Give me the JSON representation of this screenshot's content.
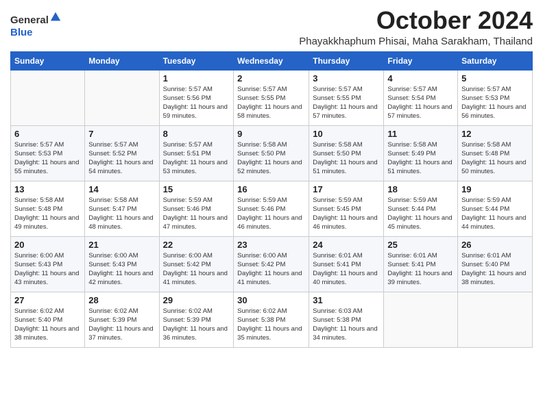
{
  "header": {
    "logo_general": "General",
    "logo_blue": "Blue",
    "month": "October 2024",
    "location": "Phayakkhaphum Phisai, Maha Sarakham, Thailand"
  },
  "weekdays": [
    "Sunday",
    "Monday",
    "Tuesday",
    "Wednesday",
    "Thursday",
    "Friday",
    "Saturday"
  ],
  "weeks": [
    [
      {
        "day": "",
        "sunrise": "",
        "sunset": "",
        "daylight": ""
      },
      {
        "day": "",
        "sunrise": "",
        "sunset": "",
        "daylight": ""
      },
      {
        "day": "1",
        "sunrise": "Sunrise: 5:57 AM",
        "sunset": "Sunset: 5:56 PM",
        "daylight": "Daylight: 11 hours and 59 minutes."
      },
      {
        "day": "2",
        "sunrise": "Sunrise: 5:57 AM",
        "sunset": "Sunset: 5:55 PM",
        "daylight": "Daylight: 11 hours and 58 minutes."
      },
      {
        "day": "3",
        "sunrise": "Sunrise: 5:57 AM",
        "sunset": "Sunset: 5:55 PM",
        "daylight": "Daylight: 11 hours and 57 minutes."
      },
      {
        "day": "4",
        "sunrise": "Sunrise: 5:57 AM",
        "sunset": "Sunset: 5:54 PM",
        "daylight": "Daylight: 11 hours and 57 minutes."
      },
      {
        "day": "5",
        "sunrise": "Sunrise: 5:57 AM",
        "sunset": "Sunset: 5:53 PM",
        "daylight": "Daylight: 11 hours and 56 minutes."
      }
    ],
    [
      {
        "day": "6",
        "sunrise": "Sunrise: 5:57 AM",
        "sunset": "Sunset: 5:53 PM",
        "daylight": "Daylight: 11 hours and 55 minutes."
      },
      {
        "day": "7",
        "sunrise": "Sunrise: 5:57 AM",
        "sunset": "Sunset: 5:52 PM",
        "daylight": "Daylight: 11 hours and 54 minutes."
      },
      {
        "day": "8",
        "sunrise": "Sunrise: 5:57 AM",
        "sunset": "Sunset: 5:51 PM",
        "daylight": "Daylight: 11 hours and 53 minutes."
      },
      {
        "day": "9",
        "sunrise": "Sunrise: 5:58 AM",
        "sunset": "Sunset: 5:50 PM",
        "daylight": "Daylight: 11 hours and 52 minutes."
      },
      {
        "day": "10",
        "sunrise": "Sunrise: 5:58 AM",
        "sunset": "Sunset: 5:50 PM",
        "daylight": "Daylight: 11 hours and 51 minutes."
      },
      {
        "day": "11",
        "sunrise": "Sunrise: 5:58 AM",
        "sunset": "Sunset: 5:49 PM",
        "daylight": "Daylight: 11 hours and 51 minutes."
      },
      {
        "day": "12",
        "sunrise": "Sunrise: 5:58 AM",
        "sunset": "Sunset: 5:48 PM",
        "daylight": "Daylight: 11 hours and 50 minutes."
      }
    ],
    [
      {
        "day": "13",
        "sunrise": "Sunrise: 5:58 AM",
        "sunset": "Sunset: 5:48 PM",
        "daylight": "Daylight: 11 hours and 49 minutes."
      },
      {
        "day": "14",
        "sunrise": "Sunrise: 5:58 AM",
        "sunset": "Sunset: 5:47 PM",
        "daylight": "Daylight: 11 hours and 48 minutes."
      },
      {
        "day": "15",
        "sunrise": "Sunrise: 5:59 AM",
        "sunset": "Sunset: 5:46 PM",
        "daylight": "Daylight: 11 hours and 47 minutes."
      },
      {
        "day": "16",
        "sunrise": "Sunrise: 5:59 AM",
        "sunset": "Sunset: 5:46 PM",
        "daylight": "Daylight: 11 hours and 46 minutes."
      },
      {
        "day": "17",
        "sunrise": "Sunrise: 5:59 AM",
        "sunset": "Sunset: 5:45 PM",
        "daylight": "Daylight: 11 hours and 46 minutes."
      },
      {
        "day": "18",
        "sunrise": "Sunrise: 5:59 AM",
        "sunset": "Sunset: 5:44 PM",
        "daylight": "Daylight: 11 hours and 45 minutes."
      },
      {
        "day": "19",
        "sunrise": "Sunrise: 5:59 AM",
        "sunset": "Sunset: 5:44 PM",
        "daylight": "Daylight: 11 hours and 44 minutes."
      }
    ],
    [
      {
        "day": "20",
        "sunrise": "Sunrise: 6:00 AM",
        "sunset": "Sunset: 5:43 PM",
        "daylight": "Daylight: 11 hours and 43 minutes."
      },
      {
        "day": "21",
        "sunrise": "Sunrise: 6:00 AM",
        "sunset": "Sunset: 5:43 PM",
        "daylight": "Daylight: 11 hours and 42 minutes."
      },
      {
        "day": "22",
        "sunrise": "Sunrise: 6:00 AM",
        "sunset": "Sunset: 5:42 PM",
        "daylight": "Daylight: 11 hours and 41 minutes."
      },
      {
        "day": "23",
        "sunrise": "Sunrise: 6:00 AM",
        "sunset": "Sunset: 5:42 PM",
        "daylight": "Daylight: 11 hours and 41 minutes."
      },
      {
        "day": "24",
        "sunrise": "Sunrise: 6:01 AM",
        "sunset": "Sunset: 5:41 PM",
        "daylight": "Daylight: 11 hours and 40 minutes."
      },
      {
        "day": "25",
        "sunrise": "Sunrise: 6:01 AM",
        "sunset": "Sunset: 5:41 PM",
        "daylight": "Daylight: 11 hours and 39 minutes."
      },
      {
        "day": "26",
        "sunrise": "Sunrise: 6:01 AM",
        "sunset": "Sunset: 5:40 PM",
        "daylight": "Daylight: 11 hours and 38 minutes."
      }
    ],
    [
      {
        "day": "27",
        "sunrise": "Sunrise: 6:02 AM",
        "sunset": "Sunset: 5:40 PM",
        "daylight": "Daylight: 11 hours and 38 minutes."
      },
      {
        "day": "28",
        "sunrise": "Sunrise: 6:02 AM",
        "sunset": "Sunset: 5:39 PM",
        "daylight": "Daylight: 11 hours and 37 minutes."
      },
      {
        "day": "29",
        "sunrise": "Sunrise: 6:02 AM",
        "sunset": "Sunset: 5:39 PM",
        "daylight": "Daylight: 11 hours and 36 minutes."
      },
      {
        "day": "30",
        "sunrise": "Sunrise: 6:02 AM",
        "sunset": "Sunset: 5:38 PM",
        "daylight": "Daylight: 11 hours and 35 minutes."
      },
      {
        "day": "31",
        "sunrise": "Sunrise: 6:03 AM",
        "sunset": "Sunset: 5:38 PM",
        "daylight": "Daylight: 11 hours and 34 minutes."
      },
      {
        "day": "",
        "sunrise": "",
        "sunset": "",
        "daylight": ""
      },
      {
        "day": "",
        "sunrise": "",
        "sunset": "",
        "daylight": ""
      }
    ]
  ]
}
